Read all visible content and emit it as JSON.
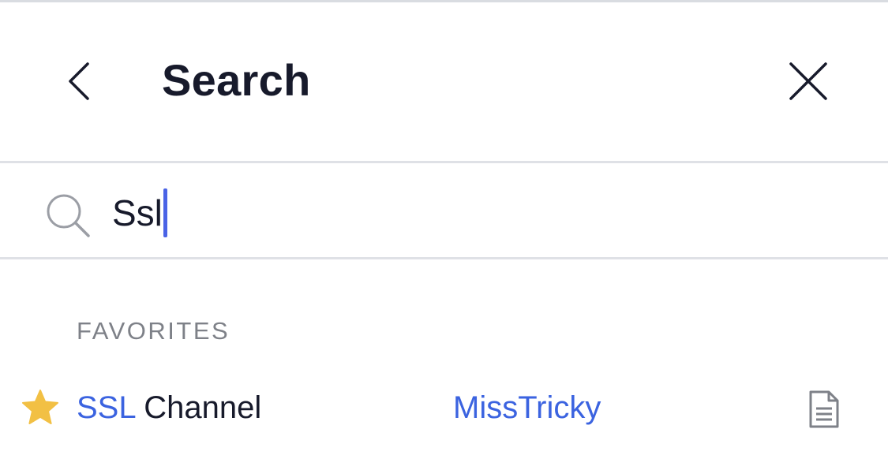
{
  "header": {
    "title": "Search",
    "back_icon": "chevron-left-icon",
    "close_icon": "close-icon"
  },
  "search": {
    "icon": "search-icon",
    "value": "Ssl",
    "caret_color": "#4a63e6"
  },
  "favorites": {
    "section_label": "FAVORITES",
    "items": [
      {
        "icon": "star-icon",
        "star_color": "#f2c044",
        "title_match": "SSL",
        "title_rest": " Channel",
        "owner": "MissTricky",
        "type_icon": "document-icon"
      }
    ]
  },
  "colors": {
    "accent": "#3b63e0",
    "text_primary": "#171a2b",
    "text_secondary": "#7e8188",
    "divider": "#dfe1e6"
  }
}
